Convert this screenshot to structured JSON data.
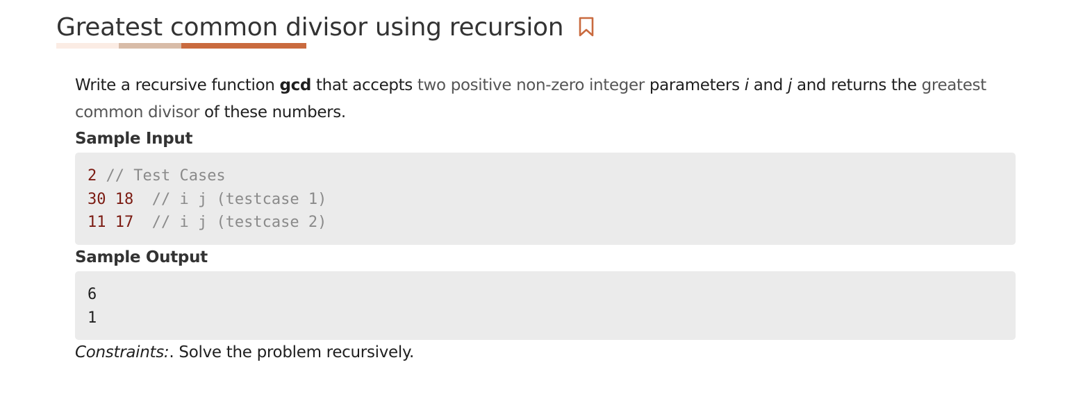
{
  "header": {
    "title": "Greatest common divisor using recursion",
    "bookmark_icon": "bookmark-icon",
    "accent_color": "#c96a3e"
  },
  "description": {
    "part1": "Write a recursive function ",
    "function_name": "gcd",
    "part2": " that accepts ",
    "highlight1": "two positive non-zero integer",
    "part3": " parameters ",
    "var_i": "i",
    "part4": " and ",
    "var_j": "j",
    "part5": " and returns the ",
    "highlight2": "greatest common divisor",
    "part6": " of these numbers."
  },
  "sample_input": {
    "label": "Sample Input",
    "lines": [
      {
        "num": "2",
        "comment": " // Test Cases"
      },
      {
        "num": "30 18",
        "comment": "  // i j (testcase 1)"
      },
      {
        "num": "11 17",
        "comment": "  // i j (testcase 2)"
      }
    ]
  },
  "sample_output": {
    "label": "Sample Output",
    "lines": [
      "6",
      "1"
    ]
  },
  "constraints": {
    "label": "Constraints:",
    "text": ". Solve the problem recursively."
  }
}
